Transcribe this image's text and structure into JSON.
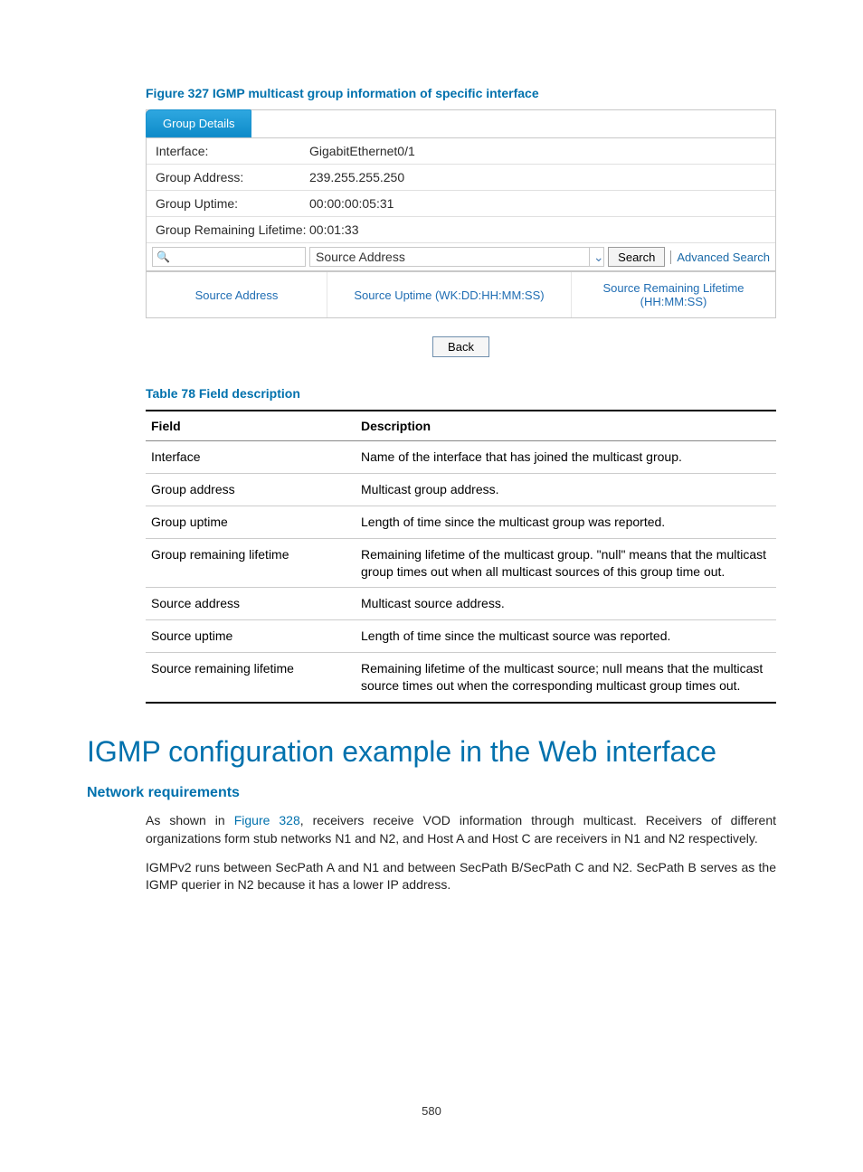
{
  "figure_caption": "Figure 327 IGMP multicast group information of specific interface",
  "panel": {
    "tab": "Group Details",
    "rows": [
      {
        "label": "Interface:",
        "value": "GigabitEthernet0/1"
      },
      {
        "label": "Group Address:",
        "value": "239.255.255.250"
      },
      {
        "label": "Group Uptime:",
        "value": "00:00:00:05:31"
      },
      {
        "label": "Group Remaining Lifetime:",
        "value": "00:01:33"
      }
    ],
    "search": {
      "input_value": "",
      "select_value": "Source Address",
      "button": "Search",
      "advanced": "Advanced Search"
    },
    "columns": {
      "c1": "Source Address",
      "c2": "Source Uptime (WK:DD:HH:MM:SS)",
      "c3": "Source Remaining Lifetime (HH:MM:SS)"
    }
  },
  "back_button": "Back",
  "table_caption": "Table 78 Field description",
  "desc_headers": {
    "h1": "Field",
    "h2": "Description"
  },
  "desc_rows": [
    {
      "f": "Interface",
      "d": "Name of the interface that has joined the multicast group."
    },
    {
      "f": "Group address",
      "d": "Multicast group address."
    },
    {
      "f": "Group uptime",
      "d": "Length of time since the multicast group was reported."
    },
    {
      "f": "Group remaining lifetime",
      "d": "Remaining lifetime of the multicast group. \"null\" means that the multicast group times out when all multicast sources of this group time out."
    },
    {
      "f": "Source address",
      "d": "Multicast source address."
    },
    {
      "f": "Source uptime",
      "d": "Length of time since the multicast source was reported."
    },
    {
      "f": "Source remaining lifetime",
      "d": "Remaining lifetime of the multicast source; null means that the multicast source times out when the corresponding multicast group times out."
    }
  ],
  "h1": "IGMP configuration example in the Web interface",
  "h2": "Network requirements",
  "para1_pre": "As shown in ",
  "para1_link": "Figure 328",
  "para1_post": ", receivers receive VOD information through multicast. Receivers of different organizations form stub networks N1 and N2, and Host A and Host C are receivers in N1 and N2 respectively.",
  "para2": "IGMPv2 runs between SecPath A and N1 and between SecPath B/SecPath C and N2. SecPath B serves as the IGMP querier in N2 because it has a lower IP address.",
  "page_number": "580"
}
